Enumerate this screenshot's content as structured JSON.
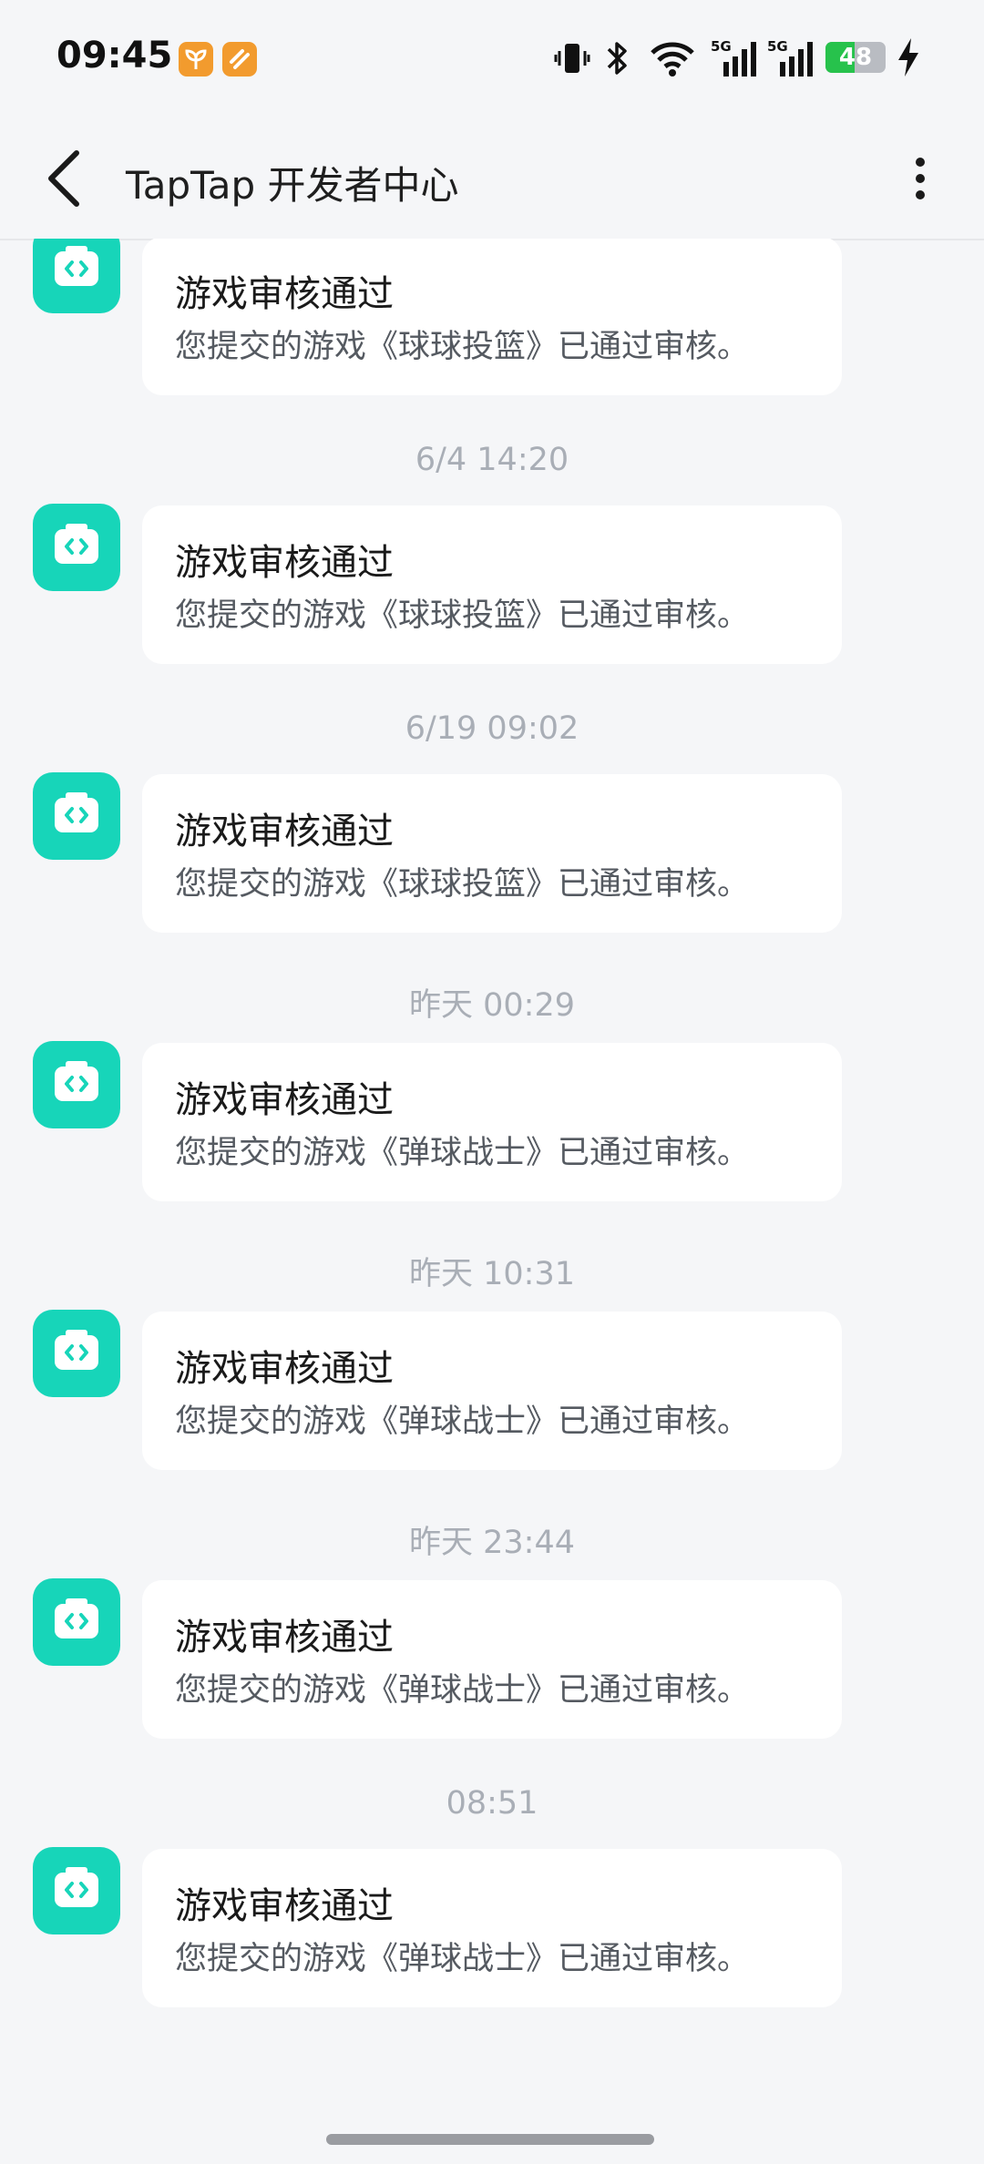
{
  "status_bar": {
    "time": "09:45",
    "battery_level": "48",
    "battery_fraction": 0.48,
    "battery_color": "#27c24c",
    "icons": [
      "vibrate-icon",
      "bluetooth-icon",
      "wifi-icon",
      "signal-5g-icon",
      "signal-5g-icon",
      "charging-icon"
    ],
    "signal_label": "5G"
  },
  "app_bar": {
    "title": "TapTap 开发者中心",
    "back_icon": "chevron-left-icon",
    "more_icon": "more-vertical-icon"
  },
  "accent_color": "#17d5b9",
  "messages": [
    {
      "time": "",
      "title": "游戏审核通过",
      "body": "您提交的游戏《球球投篮》已通过审核。"
    },
    {
      "time": "6/4 14:20",
      "title": "游戏审核通过",
      "body": "您提交的游戏《球球投篮》已通过审核。"
    },
    {
      "time": "6/19 09:02",
      "title": "游戏审核通过",
      "body": "您提交的游戏《球球投篮》已通过审核。"
    },
    {
      "time": "昨天 00:29",
      "title": "游戏审核通过",
      "body": "您提交的游戏《弹球战士》已通过审核。"
    },
    {
      "time": "昨天 10:31",
      "title": "游戏审核通过",
      "body": "您提交的游戏《弹球战士》已通过审核。"
    },
    {
      "time": "昨天 23:44",
      "title": "游戏审核通过",
      "body": "您提交的游戏《弹球战士》已通过审核。"
    },
    {
      "time": "08:51",
      "title": "游戏审核通过",
      "body": "您提交的游戏《弹球战士》已通过审核。"
    }
  ]
}
